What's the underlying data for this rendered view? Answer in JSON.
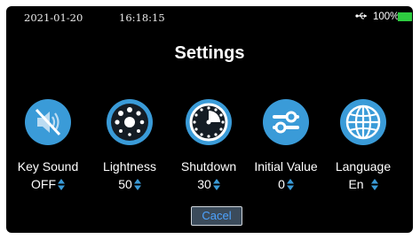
{
  "status": {
    "date": "2021-01-20",
    "time": "16:18:15",
    "battery": "100%",
    "battery_color": "#2ecc40"
  },
  "title": "Settings",
  "accent": "#3a9bd8",
  "items": [
    {
      "label": "Key Sound",
      "value": "OFF",
      "icon": "speaker-muted-icon"
    },
    {
      "label": "Lightness",
      "value": "50",
      "icon": "brightness-dots-icon"
    },
    {
      "label": "Shutdown",
      "value": "30",
      "icon": "timer-icon"
    },
    {
      "label": "Initial Value",
      "value": "0",
      "icon": "sliders-icon"
    },
    {
      "label": "Language",
      "value": "En",
      "icon": "globe-icon"
    }
  ],
  "cancel_label": "Cacel"
}
